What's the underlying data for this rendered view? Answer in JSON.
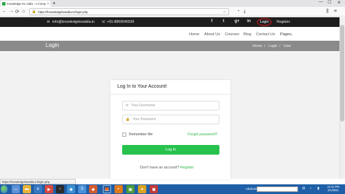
{
  "browser": {
    "tab_title": "Knowledge Ke Adda - A Complete I",
    "tab_close": "×",
    "new_tab": "+",
    "url": "https://knowledgekeadda.in/login.php",
    "back": "←",
    "forward": "→",
    "reload": "⟳",
    "home": "⌂",
    "minimize": "—",
    "maximize": "☐",
    "close": "×",
    "status_url": "https://knowledgekeadda.in/login.php"
  },
  "topbar": {
    "email": "info@knowledgekeadda.in",
    "phone": "+91-8869046539",
    "social": [
      "f",
      "t",
      "g+",
      "in"
    ],
    "login": "Login",
    "register": "Register"
  },
  "mainnav": {
    "items": [
      "Home",
      "About Us",
      "Courses",
      "Blog",
      "Contact Us"
    ],
    "pages": "Pages"
  },
  "banner": {
    "title": "Login",
    "crumbs": [
      "Home",
      "/",
      "Login",
      "/",
      "User"
    ]
  },
  "form": {
    "title": "Log In to Your Account!",
    "username_placeholder": "Your Username",
    "password_placeholder": "Your Password",
    "remember": "Remember Me",
    "forgot": "Forgot password?",
    "submit": "Log In",
    "signup_text": "Don't have an account?",
    "signup_link": "Register"
  },
  "taskbar": {
    "address_label": "Address",
    "time": "12:11 PM",
    "date": "2/1/2021"
  },
  "colors": {
    "accent_green": "#27c24c",
    "topbar_bg": "#1e1e1e",
    "banner_bg": "#8a8a8a",
    "highlight_circle": "#8b1c1c"
  }
}
